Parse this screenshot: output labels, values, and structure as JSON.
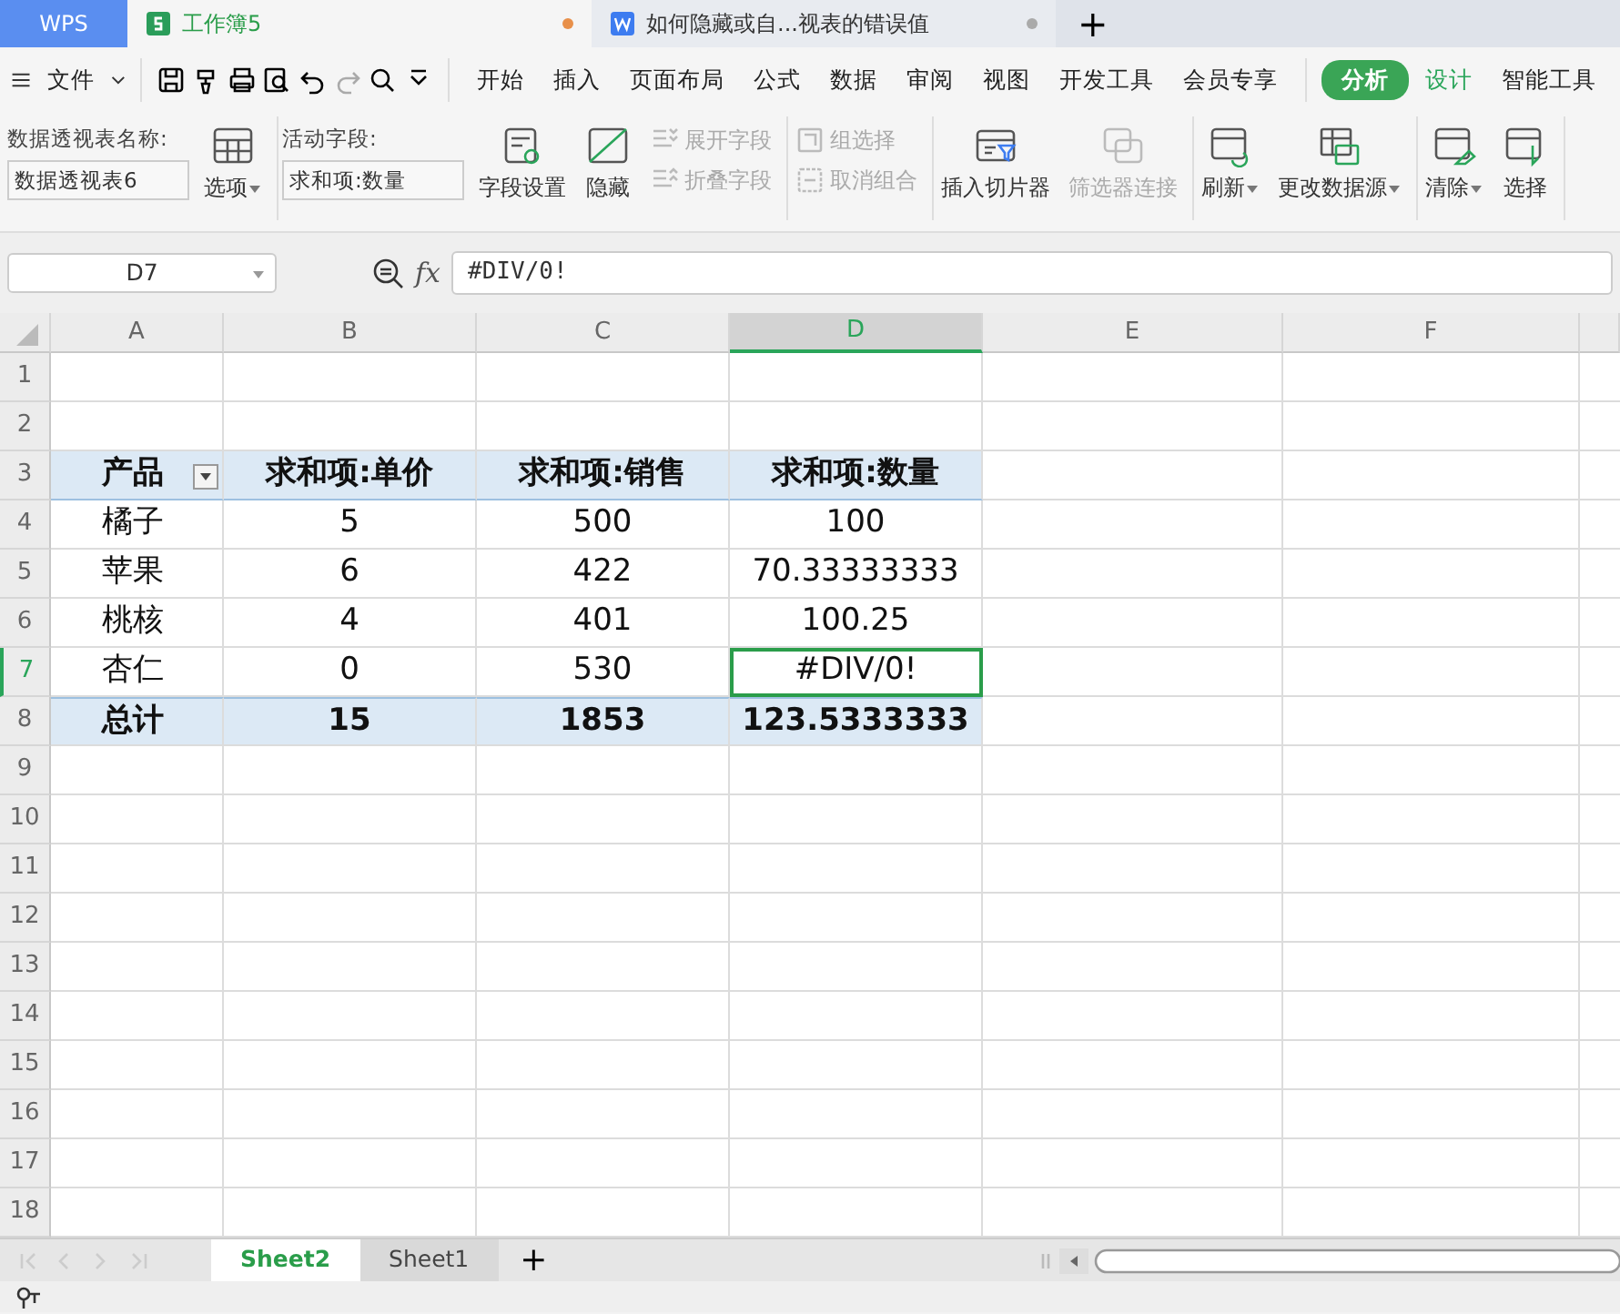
{
  "tabs": [
    {
      "label": "WPS",
      "kind": "home",
      "selected": false
    },
    {
      "label": "工作簿5",
      "kind": "sheet",
      "selected": true,
      "modified": true
    },
    {
      "label": "如何隐藏或自...视表的错误值",
      "kind": "doc",
      "selected": false,
      "modified": false
    }
  ],
  "new_tab": "+",
  "menu": {
    "file": "文件",
    "items": [
      {
        "label": "开始",
        "kind": "normal",
        "selected": false
      },
      {
        "label": "插入",
        "kind": "normal",
        "selected": false
      },
      {
        "label": "页面布局",
        "kind": "normal",
        "selected": false
      },
      {
        "label": "公式",
        "kind": "normal",
        "selected": false
      },
      {
        "label": "数据",
        "kind": "normal",
        "selected": false
      },
      {
        "label": "审阅",
        "kind": "normal",
        "selected": false
      },
      {
        "label": "视图",
        "kind": "normal",
        "selected": false
      },
      {
        "label": "开发工具",
        "kind": "normal",
        "selected": false
      },
      {
        "label": "会员专享",
        "kind": "normal",
        "selected": false
      },
      {
        "label": "分析",
        "kind": "context",
        "selected": true
      },
      {
        "label": "设计",
        "kind": "context",
        "selected": false
      },
      {
        "label": "智能工具",
        "kind": "normal",
        "selected": false
      }
    ]
  },
  "ribbon": {
    "groups": [
      [
        {
          "kind": "field",
          "label": "数据透视表名称:",
          "value": "数据透视表6"
        },
        {
          "kind": "large",
          "label": "选项",
          "caret": true,
          "disabled": false
        }
      ],
      [
        {
          "kind": "field",
          "label": "活动字段:",
          "value": "求和项:数量"
        },
        {
          "kind": "large",
          "label": "字段设置",
          "caret": false,
          "disabled": false
        },
        {
          "kind": "large",
          "label": "隐藏",
          "caret": false,
          "disabled": false
        },
        {
          "kind": "stack",
          "items": [
            {
              "label": "展开字段",
              "disabled": true
            },
            {
              "label": "折叠字段",
              "disabled": true
            }
          ]
        }
      ],
      [
        {
          "kind": "stack",
          "items": [
            {
              "label": "组选择",
              "disabled": true
            },
            {
              "label": "取消组合",
              "disabled": true
            }
          ]
        }
      ],
      [
        {
          "kind": "large",
          "label": "插入切片器",
          "caret": false,
          "disabled": false
        },
        {
          "kind": "large",
          "label": "筛选器连接",
          "caret": false,
          "disabled": true
        }
      ],
      [
        {
          "kind": "large",
          "label": "刷新",
          "caret": true,
          "disabled": false
        },
        {
          "kind": "large",
          "label": "更改数据源",
          "caret": true,
          "disabled": false
        }
      ],
      [
        {
          "kind": "large",
          "label": "清除",
          "caret": true,
          "disabled": false
        },
        {
          "kind": "large",
          "label": "选择",
          "caret": false,
          "disabled": false
        }
      ]
    ]
  },
  "formula_bar": {
    "name_box": "D7",
    "fx": "fx",
    "formula": "#DIV/0!"
  },
  "sheet": {
    "columns": [
      {
        "label": "A",
        "selected": false
      },
      {
        "label": "B",
        "selected": false
      },
      {
        "label": "C",
        "selected": false
      },
      {
        "label": "D",
        "selected": true
      },
      {
        "label": "E",
        "selected": false
      },
      {
        "label": "F",
        "selected": false
      }
    ],
    "rows": [
      {
        "number": "1",
        "selected": false,
        "cells": []
      },
      {
        "number": "2",
        "selected": false,
        "cells": []
      },
      {
        "number": "3",
        "kind": "header",
        "selected": false,
        "filter_button": true,
        "cells": [
          "产品",
          "求和项:单价",
          "求和项:销售",
          "求和项:数量"
        ]
      },
      {
        "number": "4",
        "kind": "data",
        "selected": false,
        "cells": [
          "橘子",
          "5",
          "500",
          "100"
        ]
      },
      {
        "number": "5",
        "kind": "data",
        "selected": false,
        "cells": [
          "苹果",
          "6",
          "422",
          "70.33333333"
        ]
      },
      {
        "number": "6",
        "kind": "data",
        "selected": false,
        "cells": [
          "桃核",
          "4",
          "401",
          "100.25"
        ]
      },
      {
        "number": "7",
        "kind": "data",
        "selected": true,
        "cells": [
          "杏仁",
          "0",
          "530",
          "#DIV/0!"
        ]
      },
      {
        "number": "8",
        "kind": "total",
        "selected": false,
        "cells": [
          "总计",
          "15",
          "1853",
          "123.5333333"
        ]
      },
      {
        "number": "9",
        "selected": false,
        "cells": []
      },
      {
        "number": "10",
        "selected": false,
        "cells": []
      },
      {
        "number": "11",
        "selected": false,
        "cells": []
      },
      {
        "number": "12",
        "selected": false,
        "cells": []
      },
      {
        "number": "13",
        "selected": false,
        "cells": []
      },
      {
        "number": "14",
        "selected": false,
        "cells": []
      },
      {
        "number": "15",
        "selected": false,
        "cells": []
      },
      {
        "number": "16",
        "selected": false,
        "cells": []
      },
      {
        "number": "17",
        "selected": false,
        "cells": []
      },
      {
        "number": "18",
        "selected": false,
        "cells": []
      }
    ]
  },
  "sheet_tabs": [
    {
      "label": "Sheet2",
      "selected": true
    },
    {
      "label": "Sheet1",
      "selected": false
    }
  ],
  "add_sheet": "+"
}
